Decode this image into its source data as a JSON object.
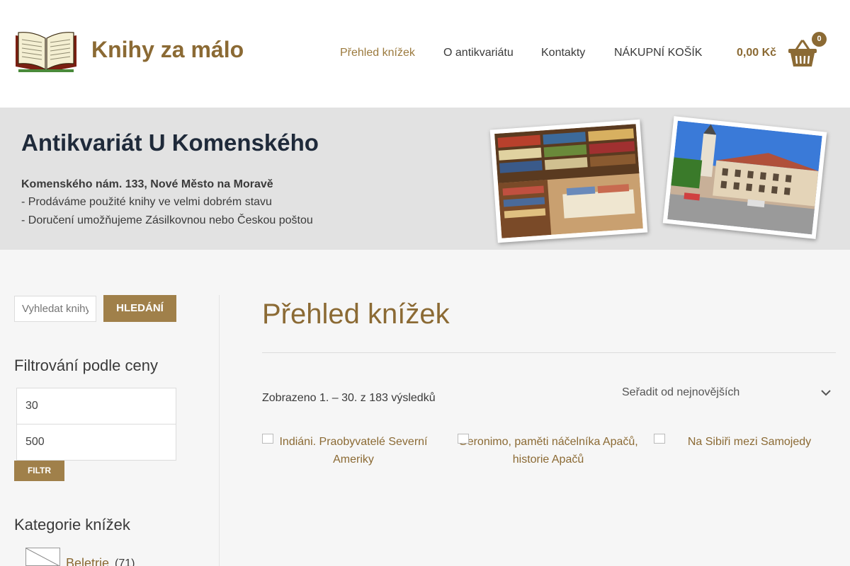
{
  "header": {
    "site_title": "Knihy za málo",
    "nav": [
      "Přehled knížek",
      "O antikvariátu",
      "Kontakty",
      "NÁKUPNÍ KOŠÍK"
    ],
    "active_nav": "Přehled knížek",
    "cart": {
      "total": "0,00 Kč",
      "count": "0"
    }
  },
  "banner": {
    "title": "Antikvariát U Komenského",
    "address": "Komenského nám. 133, Nové Město na Moravě",
    "lines": [
      "- Prodáváme použité knihy ve velmi dobrém stavu",
      "- Doručení umožňujeme Zásilkovnou nebo Českou poštou"
    ]
  },
  "sidebar": {
    "search_placeholder": "Vyhledat knihy…",
    "search_button": "HLEDÁNÍ",
    "price_filter": {
      "title": "Filtrování podle ceny",
      "min": "30",
      "max": "500",
      "button": "FILTR"
    },
    "categories": {
      "title": "Kategorie knížek",
      "items": [
        {
          "label": "Beletrie",
          "count": "(71)"
        }
      ]
    }
  },
  "main": {
    "title": "Přehled knížek",
    "result_count": "Zobrazeno 1. – 30. z 183 výsledků",
    "sort": "Seřadit od nejnovějších",
    "products": [
      "Indiáni. Praobyvatelé Severní Ameriky",
      "Geronimo, paměti náčelníka Apačů, historie Apačů",
      "Na Sibiři mezi Samojedy"
    ]
  },
  "colors": {
    "accent": "#8b6a34",
    "button": "#a0804a",
    "banner_bg": "#e2e2e2",
    "page_bg": "#f6f6f6"
  }
}
